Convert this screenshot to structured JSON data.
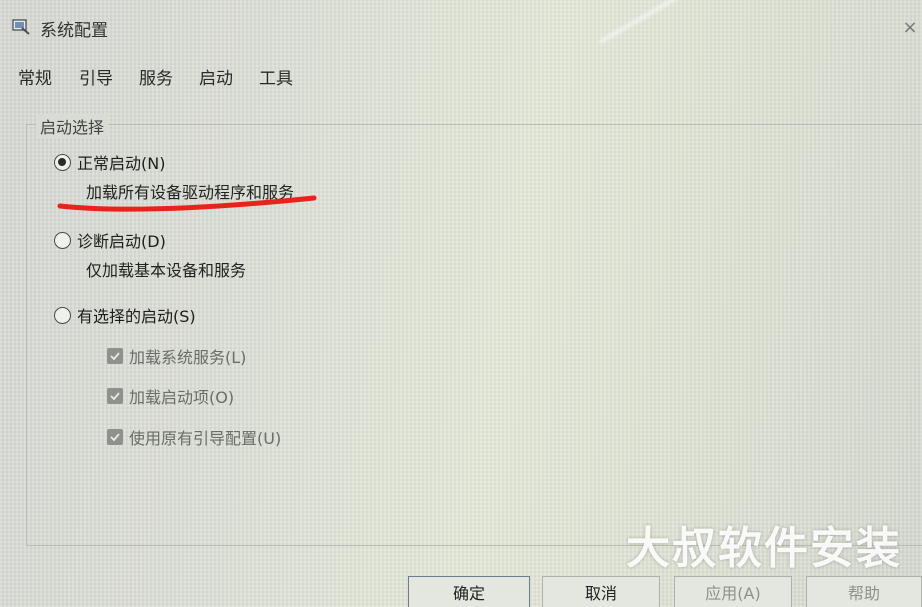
{
  "window": {
    "title": "系统配置",
    "close_glyph": "×"
  },
  "tabs": [
    {
      "label": "常规"
    },
    {
      "label": "引导"
    },
    {
      "label": "服务"
    },
    {
      "label": "启动"
    },
    {
      "label": "工具"
    }
  ],
  "startup_selection": {
    "legend": "启动选择",
    "options": [
      {
        "label": "正常启动(N)",
        "description": "加载所有设备驱动程序和服务",
        "checked": true
      },
      {
        "label": "诊断启动(D)",
        "description": "仅加载基本设备和服务",
        "checked": false
      },
      {
        "label": "有选择的启动(S)",
        "checked": false
      }
    ],
    "selective_items": [
      {
        "label": "加载系统服务(L)",
        "checked": true
      },
      {
        "label": "加载启动项(O)",
        "checked": true
      },
      {
        "label": "使用原有引导配置(U)",
        "checked": true
      }
    ]
  },
  "buttons": {
    "ok": "确定",
    "cancel": "取消",
    "apply": "应用(A)",
    "help": "帮助"
  },
  "annotation": {
    "underline_color": "#e8231c"
  },
  "watermark": "大叔软件安装",
  "colors": {
    "accent_border": "#6d7c8f"
  }
}
